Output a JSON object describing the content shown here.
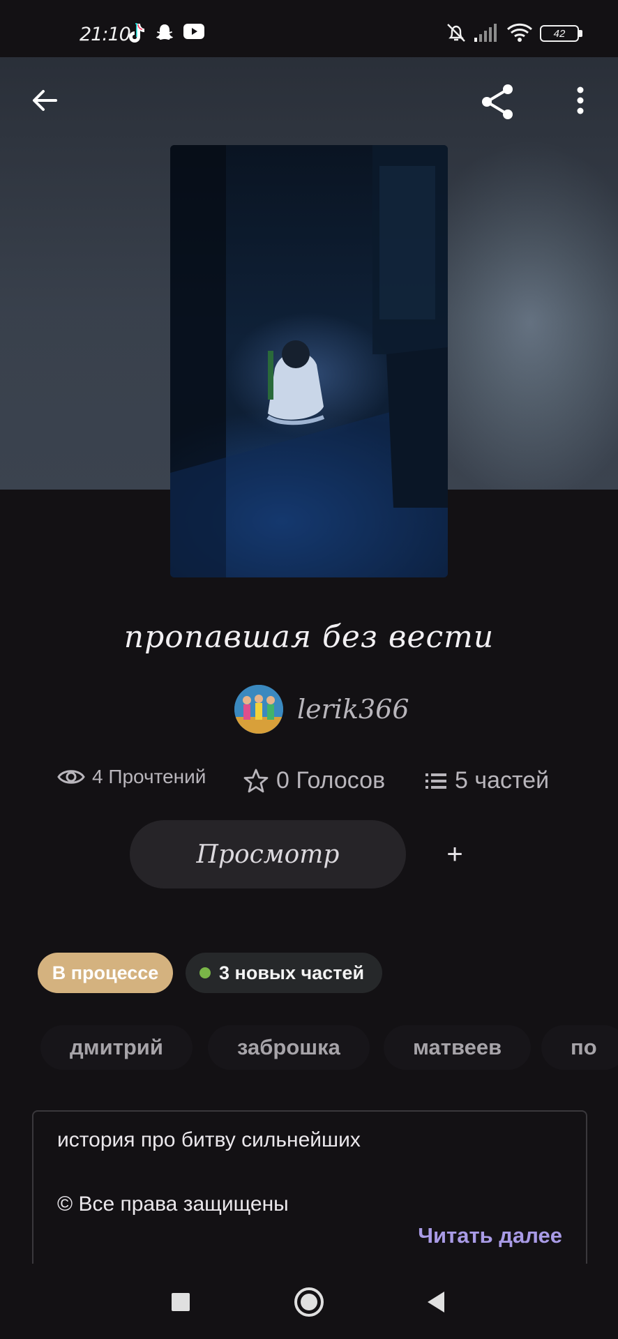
{
  "status_bar": {
    "time": "21:10",
    "battery": "42",
    "icons": [
      "tiktok-icon",
      "snapchat-icon",
      "youtube-icon",
      "mute-icon",
      "signal-icon",
      "wifi-icon",
      "battery-icon"
    ]
  },
  "top_bar": {
    "back_icon": "arrow-left-icon",
    "share_icon": "share-icon",
    "menu_icon": "more-vertical-icon"
  },
  "story": {
    "title": "пропавшая без вести",
    "author": "lerik366",
    "stats": {
      "reads": "4 Прочтений",
      "votes": "0 Голосов",
      "parts": "5 частей"
    },
    "view_button": "Просмотр",
    "add_button": "+",
    "badges": {
      "status": "В процессе",
      "new_parts": "3 новых частей"
    },
    "tags": [
      "дмитрий",
      "заброшка",
      "матвеев",
      "по"
    ],
    "description": {
      "line1": "история про битву сильнейших",
      "line2": "© Все права защищены",
      "read_more": "Читать далее"
    }
  },
  "colors": {
    "background": "#131114",
    "accent_badge": "#d4b27f",
    "new_dot": "#7ab648",
    "read_more": "#a99be6"
  },
  "nav_bar": {
    "icons": [
      "square-recent-icon",
      "circle-home-icon",
      "triangle-back-icon"
    ]
  }
}
